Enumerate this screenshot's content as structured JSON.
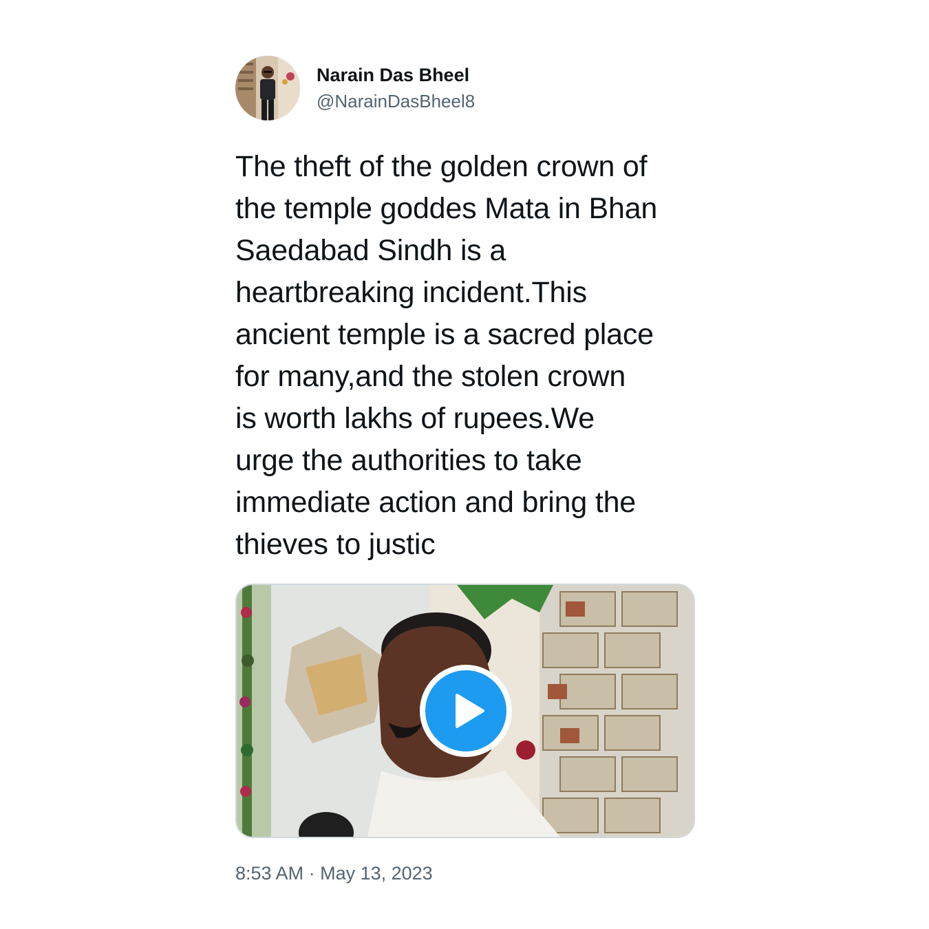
{
  "tweet": {
    "display_name": "Narain Das Bheel",
    "handle": "@NarainDasBheel8",
    "text": "The theft of the golden crown of\nthe temple goddes Mata in Bhan\nSaedabad Sindh is a\nheartbreaking incident.This\nancient temple is a sacred place\nfor many,and the stolen crown\nis worth lakhs of rupees.We\nurge the authorities to take\nimmediate action and bring the\nthieves to justic",
    "time": "8:53 AM",
    "separator": "·",
    "date": "May 13, 2023"
  },
  "media": {
    "type": "video",
    "play_icon": "play-icon"
  },
  "colors": {
    "text_primary": "#0f1419",
    "text_secondary": "#536471",
    "accent": "#1d9bf0",
    "border": "#cfd9de"
  }
}
